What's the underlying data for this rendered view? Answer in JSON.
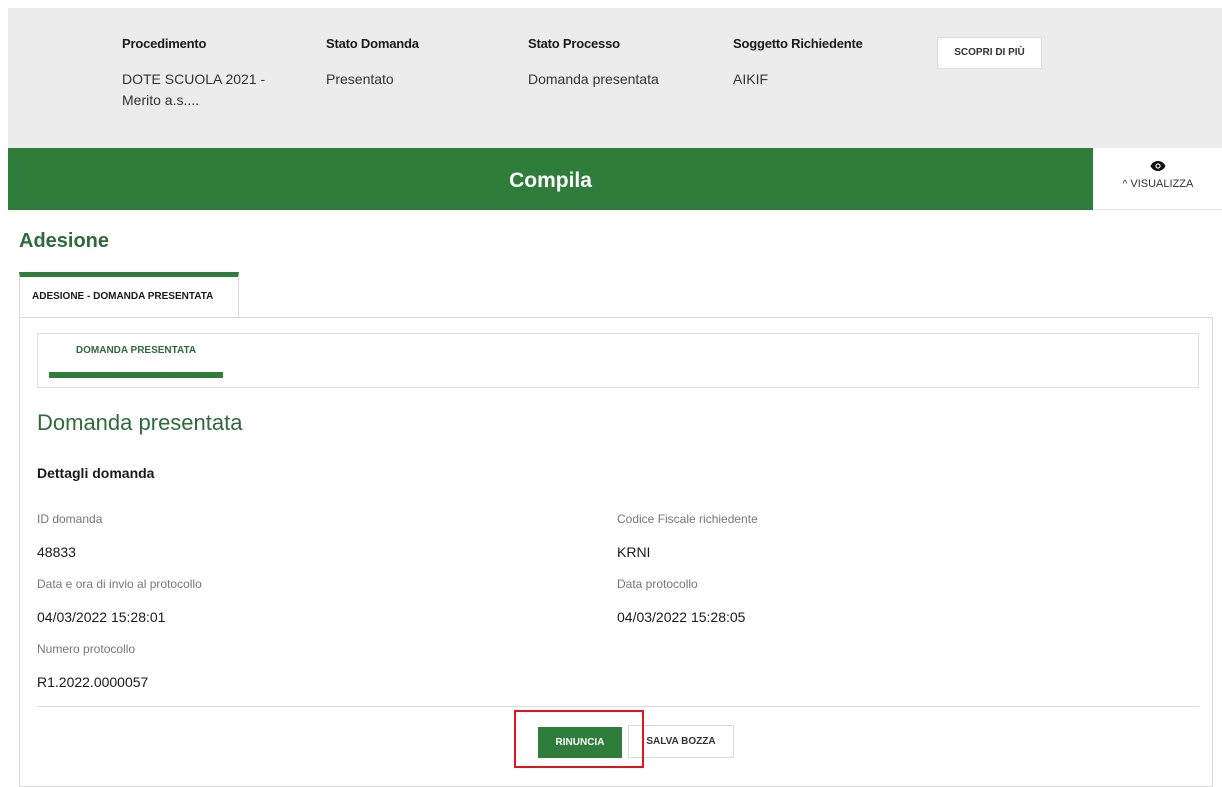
{
  "header": {
    "columns": [
      {
        "title": "Procedimento",
        "value": "DOTE SCUOLA 2021 - Merito a.s...."
      },
      {
        "title": "Stato Domanda",
        "value": "Presentato"
      },
      {
        "title": "Stato Processo",
        "value": "Domanda presentata"
      },
      {
        "title": "Soggetto Richiedente",
        "value": "AIKIF"
      }
    ],
    "more_button": "SCOPRI DI PIÙ"
  },
  "banner": {
    "title": "Compila",
    "view_toggle": "VISUALIZZA",
    "view_icon": "eye-icon",
    "chevron_glyph": "^"
  },
  "section": {
    "title": "Adesione",
    "outer_tab": "ADESIONE - DOMANDA PRESENTATA",
    "inner_tab": "DOMANDA PRESENTATA"
  },
  "content": {
    "title": "Domanda presentata",
    "subtitle": "Dettagli domanda",
    "fields": {
      "id_label": "ID domanda",
      "id_value": "48833",
      "cf_label": "Codice Fiscale richiedente",
      "cf_value": "KRNI",
      "invio_label": "Data e ora di invio al protocollo",
      "invio_value": "04/03/2022 15:28:01",
      "data_prot_label": "Data protocollo",
      "data_prot_value": "04/03/2022 15:28:05",
      "num_prot_label": "Numero protocollo",
      "num_prot_value": "R1.2022.0000057"
    }
  },
  "actions": {
    "rinuncia": "RINUNCIA",
    "salva_bozza": "SALVA BOZZA"
  },
  "colors": {
    "brand_green": "#2f7d3a",
    "title_green": "#2f6b3a",
    "highlight_red": "#e0151b"
  }
}
